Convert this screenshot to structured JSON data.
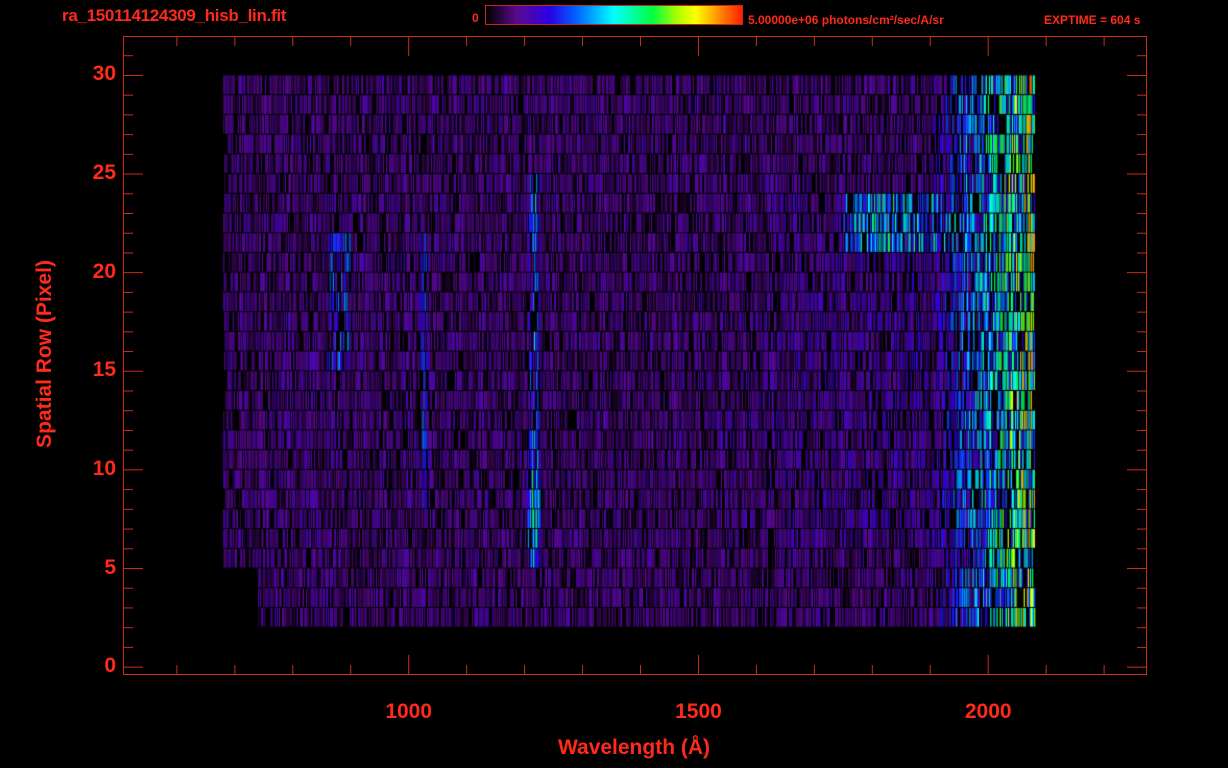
{
  "header": {
    "title": "ra_150114124309_hisb_lin.fit",
    "colorbar_min": "0",
    "colorbar_max": "5.00000e+06 photons/cm²/sec/A/sr",
    "exptime": "EXPTIME = 604 s"
  },
  "chart_data": {
    "type": "heatmap",
    "title": "ra_150114124309_hisb_lin.fit",
    "xlabel": "Wavelength (Å)",
    "ylabel": "Spatial Row (Pixel)",
    "xlim": [
      507,
      2274
    ],
    "ylim": [
      -0.4,
      32
    ],
    "x_ticks": [
      "1000",
      "1500",
      "2000"
    ],
    "x_tick_values": [
      1000,
      1500,
      2000
    ],
    "x_minor_step": 100,
    "y_ticks": [
      "0",
      "5",
      "10",
      "15",
      "20",
      "25",
      "30"
    ],
    "y_tick_values": [
      0,
      5,
      10,
      15,
      20,
      25,
      30
    ],
    "colorbar": {
      "min": 0,
      "max": 5000000,
      "units": "photons/cm^2/sec/A/sr",
      "colormap": "rainbow"
    },
    "data_extent": {
      "wavelength": [
        680,
        2080
      ],
      "rows": [
        2,
        30
      ]
    },
    "features": [
      {
        "name": "emission-line",
        "wavelength": 1216,
        "rows": [
          5,
          24
        ],
        "peak_rows": [
          6,
          10
        ],
        "peak_level": 0.65
      },
      {
        "name": "emission-line",
        "wavelength": 1026,
        "rows": [
          8,
          21
        ],
        "peak_level": 0.3
      },
      {
        "name": "emission-band",
        "wavelength": [
          860,
          900
        ],
        "rows": [
          15,
          21
        ],
        "peak_level": 0.32
      },
      {
        "name": "continuum-bright",
        "wavelength": [
          1750,
          2000
        ],
        "rows": [
          21,
          23
        ],
        "peak_level": 0.45
      },
      {
        "name": "red-end-noise",
        "wavelength": [
          1900,
          2080
        ],
        "rows": [
          2,
          30
        ],
        "peak_level": 0.55
      }
    ]
  }
}
